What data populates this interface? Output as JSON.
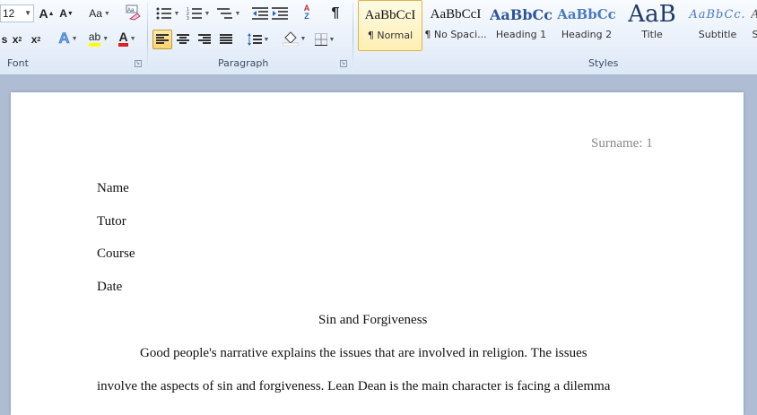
{
  "ribbon": {
    "font_group": {
      "label": "Font",
      "font_size": "12",
      "change_case_label": "Aa",
      "grow_font_label": "A",
      "shrink_font_label": "A",
      "subscript_label": "x",
      "superscript_label": "x",
      "text_effects_label": "A",
      "font_color_label": "A",
      "highlight_label": "ab"
    },
    "paragraph_group": {
      "label": "Paragraph",
      "pilcrow_label": "¶",
      "sort_label": "A↓Z"
    },
    "styles_group": {
      "label": "Styles",
      "styles": [
        {
          "preview": "AaBbCcI",
          "name": "¶ Normal"
        },
        {
          "preview": "AaBbCcI",
          "name": "¶ No Spaci..."
        },
        {
          "preview": "AaBbCc",
          "name": "Heading 1"
        },
        {
          "preview": "AaBbCc",
          "name": "Heading 2"
        },
        {
          "preview": "AaB",
          "name": "Title"
        },
        {
          "preview": "AaBbCc.",
          "name": "Subtitle"
        },
        {
          "preview": "A",
          "name": "S"
        }
      ]
    },
    "colors": {
      "highlight": "#ffff00",
      "font_color": "#e02020"
    }
  },
  "document": {
    "header": "Surname: 1",
    "name": "Name",
    "tutor": "Tutor",
    "course": "Course",
    "date": "Date",
    "title": "Sin and Forgiveness",
    "para1_line1": "Good people's narrative explains the issues that are involved in religion. The issues",
    "para1_line2": "involve the aspects of sin and forgiveness. Lean Dean is the main character is facing a dilemma"
  }
}
